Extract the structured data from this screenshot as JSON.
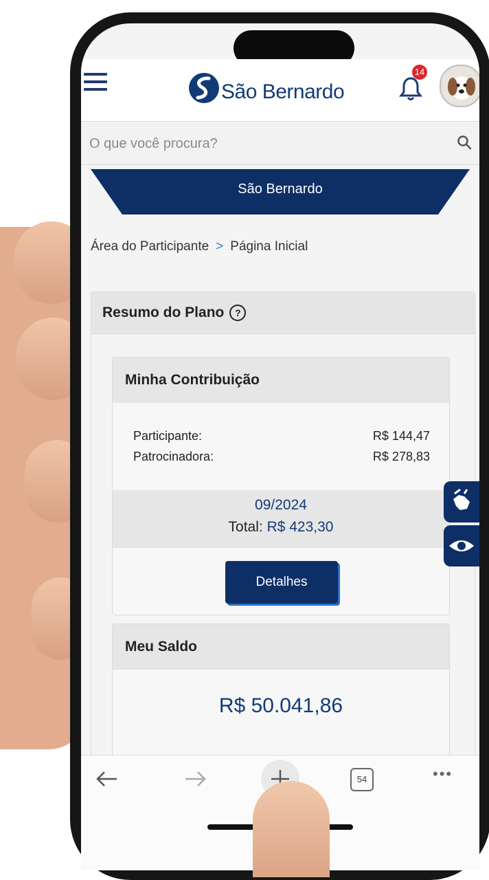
{
  "header": {
    "logo_text": "São Bernardo",
    "notifications_count": "14"
  },
  "search": {
    "placeholder": "O que você procura?"
  },
  "banner": {
    "title": "São Bernardo"
  },
  "breadcrumb": {
    "parent": "Área do Participante",
    "separator": ">",
    "current": "Página Inicial"
  },
  "plan_summary": {
    "title": "Resumo do Plano",
    "help_glyph": "?"
  },
  "contribution": {
    "title": "Minha Contribuição",
    "rows": [
      {
        "label": "Participante:",
        "value": "R$ 144,47"
      },
      {
        "label": "Patrocinadora:",
        "value": "R$ 278,83"
      }
    ],
    "period": "09/2024",
    "total_label": "Total:",
    "total_value": "R$ 423,30",
    "details_button": "Detalhes"
  },
  "balance": {
    "title": "Meu Saldo",
    "value": "R$ 50.041,86"
  },
  "browser": {
    "tab_count": "54",
    "more": "•••"
  },
  "colors": {
    "brand_navy": "#0d2f66",
    "brand_text": "#123b76",
    "badge_red": "#d9282d"
  },
  "icons": [
    "menu-icon",
    "bell-icon",
    "avatar",
    "search-icon",
    "help-icon",
    "sign-language-icon",
    "eye-icon",
    "back-arrow-icon",
    "forward-arrow-icon",
    "new-tab-icon",
    "tabs-icon",
    "more-icon"
  ]
}
